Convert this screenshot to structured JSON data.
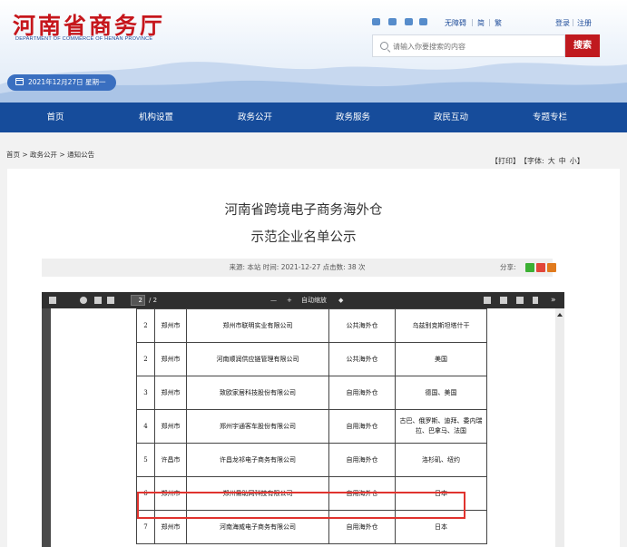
{
  "header": {
    "logo_cn": "河南省商务厅",
    "logo_en": "DEPARTMENT OF COMMERCE OF HENAN PROVINCE",
    "links": [
      "无障碍",
      "简",
      "繁",
      "登录",
      "注册"
    ],
    "search_placeholder": "请输入你要搜索的内容",
    "search_button": "搜索",
    "date": "2021年12月27日 星期一"
  },
  "nav": {
    "items": [
      "首页",
      "机构设置",
      "政务公开",
      "政务服务",
      "政民互动",
      "专题专栏"
    ]
  },
  "breadcrumb": "首页 > 政务公开 > 通知公告",
  "tools": {
    "print": "【打印】",
    "font_label": "【字体:",
    "font_large": "大",
    "font_mid": "中",
    "font_small": "小】"
  },
  "article": {
    "title_line1": "河南省跨境电子商务海外仓",
    "title_line2": "示范企业名单公示",
    "meta": "来源: 本站   时间: 2021-12-27   点击数: 38 次",
    "share_label": "分享:"
  },
  "pdf": {
    "page_current": "2",
    "page_total": "/ 2",
    "zoom_minus": "—",
    "zoom_plus": "+",
    "zoom": "自动缩放",
    "rows": [
      {
        "no": "2",
        "city": "郑州市",
        "company": "郑州市联明实业有限公司",
        "type": "公共海外仓",
        "country": "乌兹别克斯坦塔什干"
      },
      {
        "no": "2",
        "city": "郑州市",
        "company": "河南顺润供应链管理有限公司",
        "type": "公共海外仓",
        "country": "美国"
      },
      {
        "no": "3",
        "city": "郑州市",
        "company": "致欧家居科技股份有限公司",
        "type": "自用海外仓",
        "country": "德国、美国"
      },
      {
        "no": "4",
        "city": "郑州市",
        "company": "郑州宇通客车股份有限公司",
        "type": "自用海外仓",
        "country": "古巴、俄罗斯、迪拜、委内瑞拉、巴拿马、法国"
      },
      {
        "no": "5",
        "city": "许昌市",
        "company": "许昌龙祁电子商务有限公司",
        "type": "自用海外仓",
        "country": "洛杉矶、纽约"
      },
      {
        "no": "6",
        "city": "郑州市",
        "company": "郑州易助网科技有限公司",
        "type": "自用海外仓",
        "country": "日本"
      },
      {
        "no": "7",
        "city": "郑州市",
        "company": "河南海威电子商务有限公司",
        "type": "自用海外仓",
        "country": "日本"
      }
    ]
  },
  "colors": {
    "brand_red": "#c6161c",
    "nav_blue": "#164c9b",
    "highlight_red": "#e0332e"
  }
}
